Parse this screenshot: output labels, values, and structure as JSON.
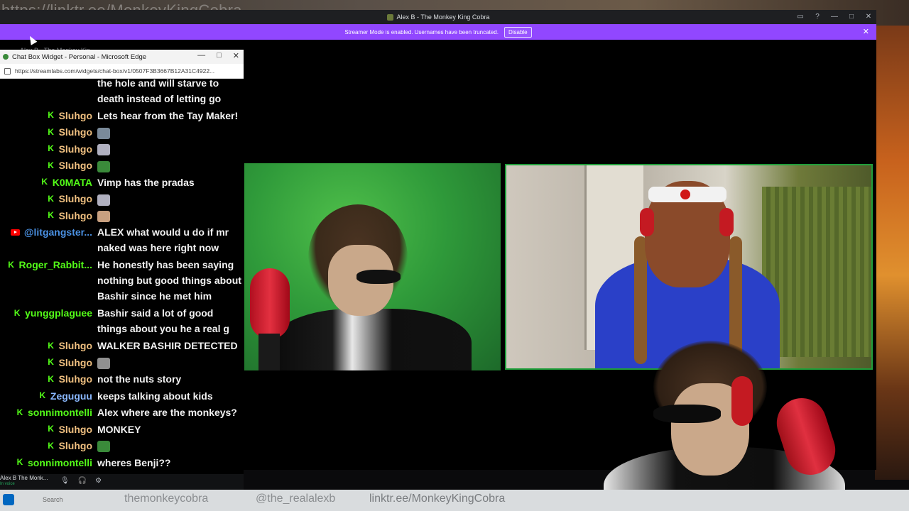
{
  "backdrop": {
    "url_overlay": "https://linktr.ee/MonkeyKingCobra"
  },
  "app": {
    "title": "Alex B - The Monkey King Cobra",
    "banner_text": "Streamer Mode is enabled. Usernames have been truncated.",
    "banner_button": "Disable",
    "ghost_tab": "Alex B - The Monkey Kin..."
  },
  "edge": {
    "title": "Chat Box Widget - Personal - Microsoft Edge",
    "url": "https://streamlabs.com/widgets/chat-box/v1/0507F3B3667B12A31C4922..."
  },
  "chat": {
    "messages": [
      {
        "platform": "",
        "user": "",
        "user_color": "#ffffff",
        "lines": [
          "the hole and will starve to",
          "death instead of letting go"
        ]
      },
      {
        "platform": "kick",
        "user": "Sluhgo",
        "user_color": "#f0c080",
        "lines": [
          "Lets hear from the Tay Maker!"
        ]
      },
      {
        "platform": "kick",
        "user": "Sluhgo",
        "user_color": "#f0c080",
        "lines": [
          ""
        ],
        "emote": "rat-emote"
      },
      {
        "platform": "kick",
        "user": "Sluhgo",
        "user_color": "#f0c080",
        "lines": [
          ""
        ],
        "emote": "bottle-emote"
      },
      {
        "platform": "kick",
        "user": "Sluhgo",
        "user_color": "#f0c080",
        "lines": [
          ""
        ],
        "emote": "snake-emote"
      },
      {
        "platform": "kick",
        "user": "K0MATA",
        "user_color": "#53fc18",
        "lines": [
          "Vimp has the pradas"
        ]
      },
      {
        "platform": "kick",
        "user": "Sluhgo",
        "user_color": "#f0c080",
        "lines": [
          ""
        ],
        "emote": "bottle-emote"
      },
      {
        "platform": "kick",
        "user": "Sluhgo",
        "user_color": "#f0c080",
        "lines": [
          ""
        ],
        "emote": "face-emote"
      },
      {
        "platform": "youtube",
        "user": "@litgangster...",
        "user_color": "#4a90e2",
        "lines": [
          "ALEX what would u do if mr",
          "naked was here right now"
        ]
      },
      {
        "platform": "kick",
        "user": "Roger_Rabbit...",
        "user_color": "#53fc18",
        "lines": [
          "He honestly has been saying",
          "nothing but good things about",
          "Bashir since he met him"
        ]
      },
      {
        "platform": "kick",
        "user": "yunggplaguee",
        "user_color": "#53fc18",
        "lines": [
          "Bashir said a lot of good",
          "things about you he a real g"
        ]
      },
      {
        "platform": "kick",
        "user": "Sluhgo",
        "user_color": "#f0c080",
        "lines": [
          "WALKER BASHIR DETECTED"
        ]
      },
      {
        "platform": "kick",
        "user": "Sluhgo",
        "user_color": "#f0c080",
        "lines": [
          ""
        ],
        "emote": "knife-emote"
      },
      {
        "platform": "kick",
        "user": "Sluhgo",
        "user_color": "#f0c080",
        "lines": [
          "not the nuts story"
        ]
      },
      {
        "platform": "kick",
        "user": "Zeguguu",
        "user_color": "#8ab8ff",
        "lines": [
          "keeps talking about kids"
        ]
      },
      {
        "platform": "kick",
        "user": "sonnimontelli",
        "user_color": "#53fc18",
        "lines": [
          "Alex where are the monkeys?"
        ]
      },
      {
        "platform": "kick",
        "user": "Sluhgo",
        "user_color": "#f0c080",
        "lines": [
          "MONKEY"
        ]
      },
      {
        "platform": "kick",
        "user": "Sluhgo",
        "user_color": "#f0c080",
        "lines": [
          ""
        ],
        "emote": "snake-emote"
      },
      {
        "platform": "kick",
        "user": "sonnimontelli",
        "user_color": "#53fc18",
        "lines": [
          "wheres Benji??"
        ]
      }
    ]
  },
  "voice": {
    "name": "Alex B The Monk...",
    "status": "In voice"
  },
  "taskbar": {
    "search_placeholder": "Search",
    "url_left": "themonkeycobra",
    "url_mid": "@the_realalexb",
    "url_right": "linktr.ee/MonkeyKingCobra"
  }
}
